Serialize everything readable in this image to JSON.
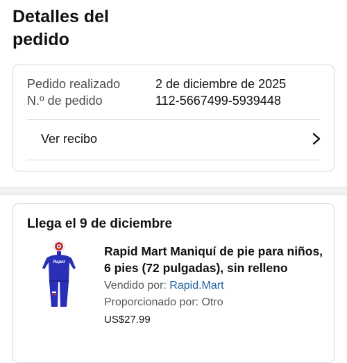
{
  "header": {
    "title": "Detalles del pedido"
  },
  "details": {
    "order_placed_label": "Pedido realizado",
    "order_placed_value": "2 de diciembre de 2025",
    "order_number_label": "N.º de pedido",
    "order_number_value": "112-5667499-5939448",
    "receipt_label": "Ver recibo",
    "receipt_icon": "chevron-right-icon"
  },
  "shipment": {
    "arrival": "Llega el 9 de diciembre",
    "product": {
      "title": "Rapid Mart Maniquí de pie para niños, 6 pies (72 pulgadas), sin relleno",
      "sold_by_label": "Vendido por: ",
      "sold_by_value": "Rapid.Mart",
      "provided_by": "Proporcionado por: Otro",
      "price": "US$27.99",
      "image_brand_text": "Rapid"
    }
  },
  "colors": {
    "link": "#2162a1",
    "product_blue": "#2a2fb8",
    "text_primary": "#0f1111",
    "text_secondary": "#565959",
    "border": "#d5d9d9"
  }
}
